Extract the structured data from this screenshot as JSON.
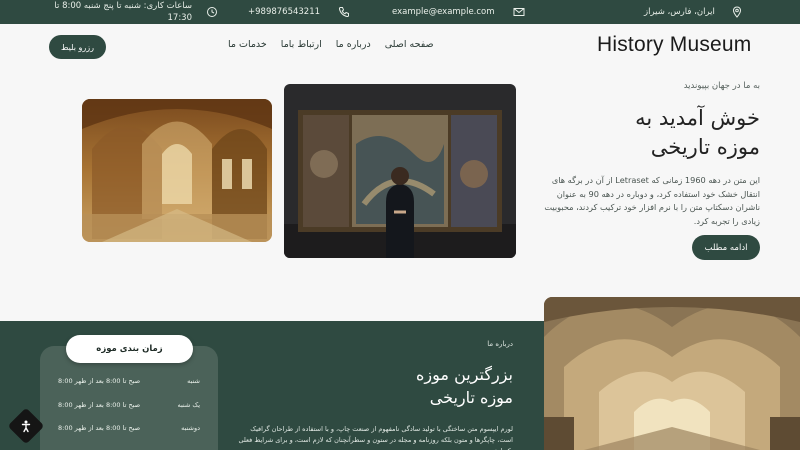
{
  "topbar": {
    "location": "ایران، فارس، شیراز",
    "email": "example@example.com",
    "phone": "+989876543211",
    "hours_line1": "ساعات کاری: شنبه تا پنج شنبه 8:00 تا",
    "hours_line2": "17:30"
  },
  "header": {
    "brand": "History Museum",
    "nav": [
      "صفحه اصلی",
      "درباره ما",
      "ارتباط باما",
      "خدمات ما"
    ],
    "book_button": "رزرو بلیط"
  },
  "hero": {
    "eyebrow": "به ما در جهان بپیوندید",
    "title_line1": "خوش آمدید به",
    "title_line2": "موزه تاریخی",
    "description": "این متن در دهه 1960 زمانی که Letraset از آن در برگه های انتقال خشک خود استفاده کرد، و دوباره در دهه 90 به عنوان ناشران دسکتاپ متن را با نرم افزار خود ترکیب کردند، محبوبیت زیادی را تجربه کرد.",
    "more_button": "ادامه مطلب"
  },
  "about": {
    "eyebrow": "درباره ما",
    "title_line1": "بزرگترین موزه",
    "title_line2": "موزه تاریخی",
    "description": "لورم ایپسوم متن ساختگی با تولید سادگی نامفهوم از صنعت چاپ، و با استفاده از طراحان گرافیک است، چاپگرها و متون بلکه روزنامه و مجله در ستون و سطرآنچنان که لازم است، و برای شرایط فعلی تکنولوژی"
  },
  "schedule": {
    "title": "زمان بندی موزه",
    "rows": [
      {
        "day": "شنبه",
        "hours": "8:00 صبح تا 8:00 بعد از ظهر"
      },
      {
        "day": "یک شنبه",
        "hours": "8:00 صبح تا 8:00 بعد از ظهر"
      },
      {
        "day": "دوشنبه",
        "hours": "8:00 صبح تا 8:00 بعد از ظهر"
      }
    ]
  },
  "colors": {
    "primary": "#2f4a41",
    "schedule_card": "#4b6259",
    "background": "#f7f7f7"
  },
  "icons": [
    "location-pin-icon",
    "mail-icon",
    "phone-icon",
    "clock-icon",
    "accessibility-icon"
  ]
}
